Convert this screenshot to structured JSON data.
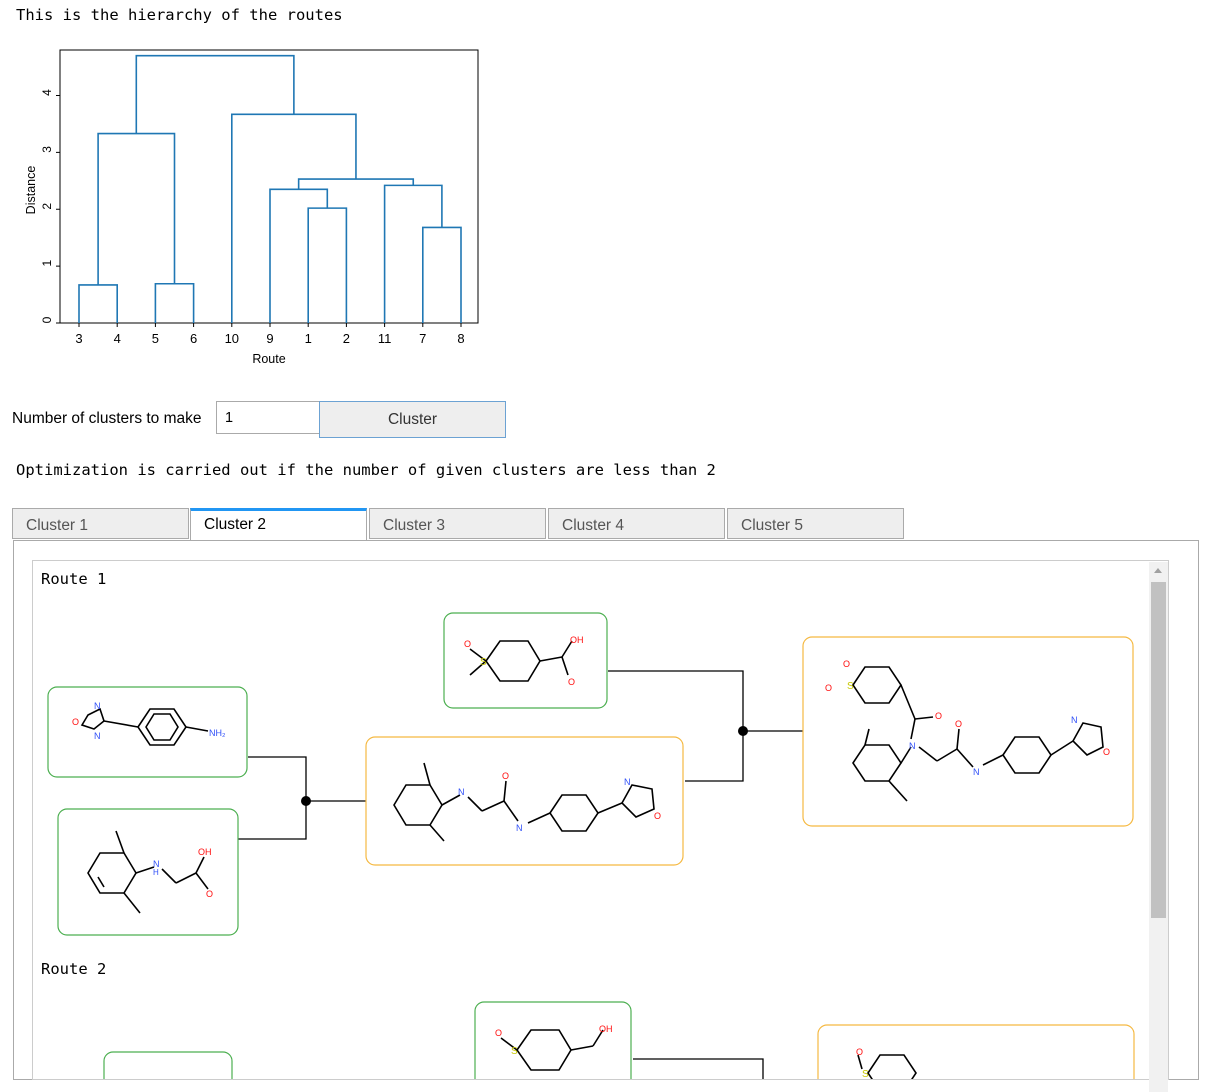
{
  "intro_text": "This is the hierarchy of the routes",
  "chart_data": {
    "type": "dendrogram",
    "xlabel": "Route",
    "ylabel": "Distance",
    "ylim": [
      0,
      4.8
    ],
    "yticks": [
      "0",
      "1",
      "2",
      "3",
      "4"
    ],
    "leaves": [
      "3",
      "4",
      "5",
      "6",
      "10",
      "9",
      "1",
      "2",
      "11",
      "7",
      "8"
    ],
    "line_color": "#1f77b4",
    "links": [
      {
        "left_x": 0,
        "right_x": 1,
        "left_h": 0,
        "right_h": 0,
        "h": 0.67
      },
      {
        "left_x": 2,
        "right_x": 3,
        "left_h": 0,
        "right_h": 0,
        "h": 0.69
      },
      {
        "left_x": 0.5,
        "right_x": 2.5,
        "left_h": 0.67,
        "right_h": 0.69,
        "h": 3.33
      },
      {
        "left_x": 6,
        "right_x": 7,
        "left_h": 0,
        "right_h": 0,
        "h": 2.02
      },
      {
        "left_x": 5,
        "right_x": 6.5,
        "left_h": 0,
        "right_h": 2.02,
        "h": 2.35
      },
      {
        "left_x": 9,
        "right_x": 10,
        "left_h": 0,
        "right_h": 0,
        "h": 1.68
      },
      {
        "left_x": 8,
        "right_x": 9.5,
        "left_h": 0,
        "right_h": 1.68,
        "h": 2.42
      },
      {
        "left_x": 5.75,
        "right_x": 8.75,
        "left_h": 2.35,
        "right_h": 2.42,
        "h": 2.53
      },
      {
        "left_x": 4,
        "right_x": 7.25,
        "left_h": 0,
        "right_h": 2.53,
        "h": 3.67
      },
      {
        "left_x": 1.5,
        "right_x": 5.625,
        "left_h": 3.33,
        "right_h": 3.67,
        "h": 4.7
      }
    ]
  },
  "controls": {
    "clusters_label": "Number of clusters to make",
    "clusters_value": "1",
    "cluster_button": "Cluster"
  },
  "optimization_note": "Optimization is carried out if the number of given clusters are less than 2",
  "tabs": [
    {
      "label": "Cluster 1",
      "active": false
    },
    {
      "label": "Cluster 2",
      "active": true
    },
    {
      "label": "Cluster 3",
      "active": false
    },
    {
      "label": "Cluster 4",
      "active": false
    },
    {
      "label": "Cluster 5",
      "active": false
    }
  ],
  "routes": [
    {
      "label": "Route 1"
    },
    {
      "label": "Route 2"
    }
  ],
  "atoms": {
    "nh2": "NH₂",
    "nh": "N",
    "h": "H",
    "oh": "OH",
    "o": "O",
    "n": "N",
    "s": "S"
  },
  "colors": {
    "reactant_box": "#4caf50",
    "intermediate_box": "#f5b942",
    "nitrogen": "#3050f8",
    "oxygen": "#ff0d0d",
    "sulfur": "#c8c800",
    "tab_accent": "#2196f3"
  }
}
